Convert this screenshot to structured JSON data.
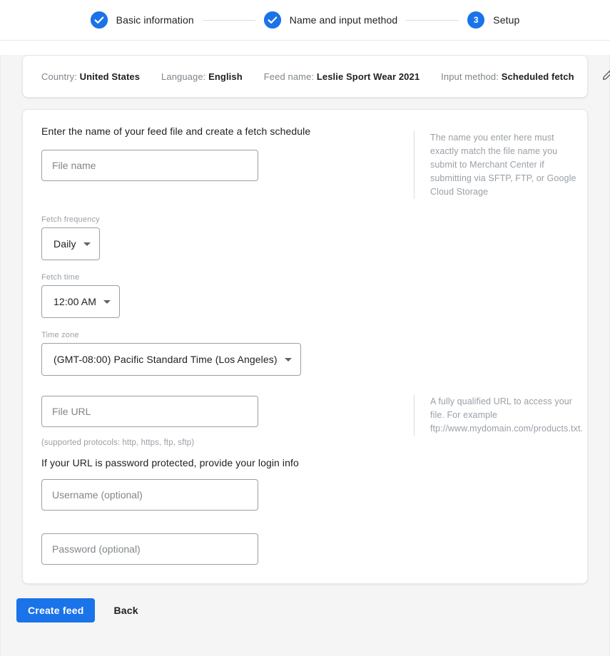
{
  "stepper": {
    "steps": [
      {
        "label": "Basic information",
        "state": "complete",
        "icon": "check-circle-icon"
      },
      {
        "label": "Name and input method",
        "state": "complete",
        "icon": "check-circle-icon"
      },
      {
        "label": "Setup",
        "state": "current",
        "number": "3"
      }
    ]
  },
  "summary": {
    "items": [
      {
        "label": "Country:",
        "value": "United States"
      },
      {
        "label": "Language:",
        "value": "English"
      },
      {
        "label": "Feed name:",
        "value": "Leslie Sport Wear 2021"
      },
      {
        "label": "Input method:",
        "value": "Scheduled fetch"
      }
    ],
    "edit_icon": "pencil-icon"
  },
  "form": {
    "section_title": "Enter the name of your feed file and create a fetch schedule",
    "file_name": {
      "placeholder": "File name",
      "value": ""
    },
    "fetch_frequency": {
      "label": "Fetch frequency",
      "value": "Daily"
    },
    "fetch_time": {
      "label": "Fetch time",
      "value": "12:00 AM"
    },
    "time_zone": {
      "label": "Time zone",
      "value": "(GMT-08:00) Pacific Standard Time (Los Angeles)"
    },
    "file_url": {
      "placeholder": "File URL",
      "value": ""
    },
    "protocols_hint": "(supported protocols: http, https, ftp, sftp)",
    "login_title": "If your URL is password protected, provide your login info",
    "username": {
      "placeholder": "Username (optional)",
      "value": ""
    },
    "password": {
      "placeholder": "Password (optional)",
      "value": ""
    }
  },
  "notes": {
    "file_name_note": "The name you enter here must exactly match the file name you submit to Merchant Center if submitting via SFTP, FTP, or Google Cloud Storage",
    "file_url_note": "A fully qualified URL to access your file. For example ftp://www.mydomain.com/products.txt."
  },
  "actions": {
    "create_label": "Create feed",
    "back_label": "Back"
  },
  "colors": {
    "accent": "#1a73e8",
    "page_background": "#f5f5f5",
    "card_background": "#ffffff",
    "text_primary": "#202124",
    "text_secondary": "#9aa0a6"
  }
}
